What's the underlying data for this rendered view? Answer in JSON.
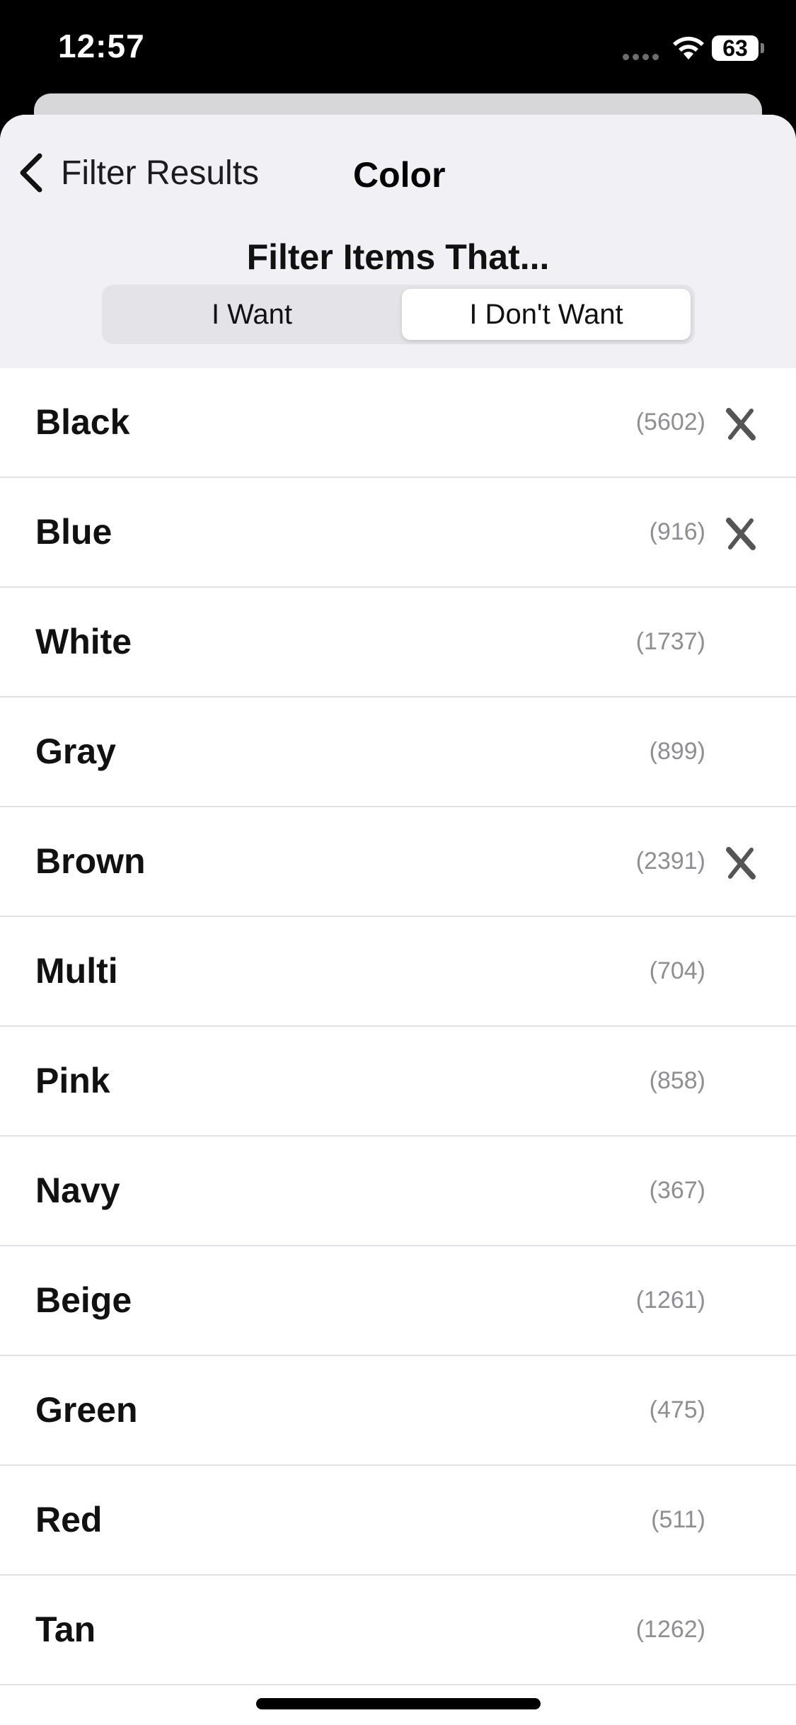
{
  "status_bar": {
    "time": "12:57",
    "battery": "63"
  },
  "nav": {
    "back_label": "Filter Results",
    "title": "Color"
  },
  "filter": {
    "heading": "Filter Items That...",
    "options": [
      "I Want",
      "I Don't Want"
    ],
    "selected": "I Don't Want"
  },
  "colors": [
    {
      "name": "Black",
      "count": "(5602)",
      "excluded": true
    },
    {
      "name": "Blue",
      "count": "(916)",
      "excluded": true
    },
    {
      "name": "White",
      "count": "(1737)",
      "excluded": false
    },
    {
      "name": "Gray",
      "count": "(899)",
      "excluded": false
    },
    {
      "name": "Brown",
      "count": "(2391)",
      "excluded": true
    },
    {
      "name": "Multi",
      "count": "(704)",
      "excluded": false
    },
    {
      "name": "Pink",
      "count": "(858)",
      "excluded": false
    },
    {
      "name": "Navy",
      "count": "(367)",
      "excluded": false
    },
    {
      "name": "Beige",
      "count": "(1261)",
      "excluded": false
    },
    {
      "name": "Green",
      "count": "(475)",
      "excluded": false
    },
    {
      "name": "Red",
      "count": "(511)",
      "excluded": false
    },
    {
      "name": "Tan",
      "count": "(1262)",
      "excluded": false
    }
  ],
  "icons": {
    "back": "chevron-left-icon",
    "excluded_marker": "x-icon",
    "wifi": "wifi-icon",
    "battery": "battery-icon"
  },
  "theme": {
    "header_bg": "#f1f1f5",
    "count_color": "#8e8e93",
    "x_color": "#555555"
  }
}
